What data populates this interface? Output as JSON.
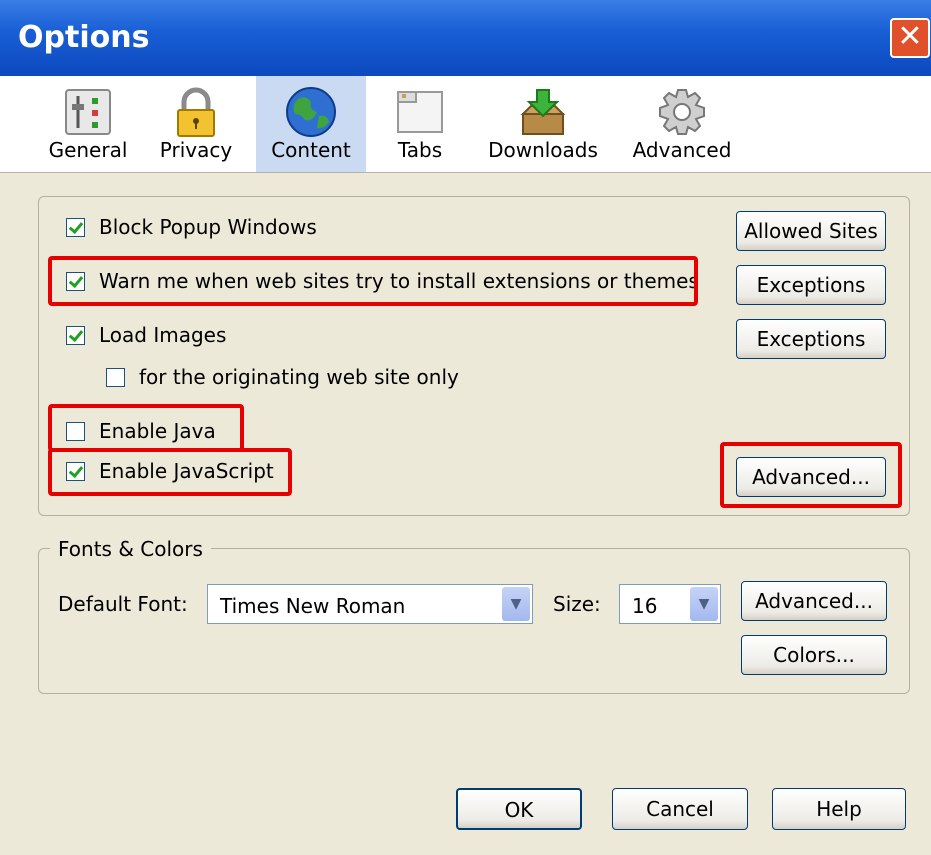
{
  "window": {
    "title": "Options",
    "close_glyph": "✕"
  },
  "tabs": [
    {
      "label": "General",
      "icon": "general-icon"
    },
    {
      "label": "Privacy",
      "icon": "lock-icon"
    },
    {
      "label": "Content",
      "icon": "globe-icon",
      "selected": true
    },
    {
      "label": "Tabs",
      "icon": "tabs-icon"
    },
    {
      "label": "Downloads",
      "icon": "download-box-icon"
    },
    {
      "label": "Advanced",
      "icon": "gear-icon"
    }
  ],
  "content": {
    "block_popups": {
      "label": "Block Popup Windows",
      "checked": true
    },
    "warn_extensions": {
      "label": "Warn me when web sites try to install extensions or themes",
      "checked": true
    },
    "load_images": {
      "label": "Load Images",
      "checked": true
    },
    "originating_only": {
      "label": "for the originating web site only",
      "checked": false
    },
    "enable_java": {
      "label": "Enable Java",
      "checked": false
    },
    "enable_javascript": {
      "label": "Enable JavaScript",
      "checked": true
    },
    "allowed_sites_btn": "Allowed Sites",
    "exceptions_btn_1": "Exceptions",
    "exceptions_btn_2": "Exceptions",
    "advanced_btn": "Advanced..."
  },
  "fonts": {
    "legend": "Fonts & Colors",
    "default_font_label": "Default Font:",
    "default_font_value": "Times New Roman",
    "size_label": "Size:",
    "size_value": "16",
    "advanced_btn": "Advanced...",
    "colors_btn": "Colors..."
  },
  "footer": {
    "ok": "OK",
    "cancel": "Cancel",
    "help": "Help"
  },
  "colors": {
    "highlight": "#e60000",
    "titlebar": "#0c49bf",
    "dialog_bg": "#ece9d8",
    "selected_tab": "#c9daf2"
  }
}
